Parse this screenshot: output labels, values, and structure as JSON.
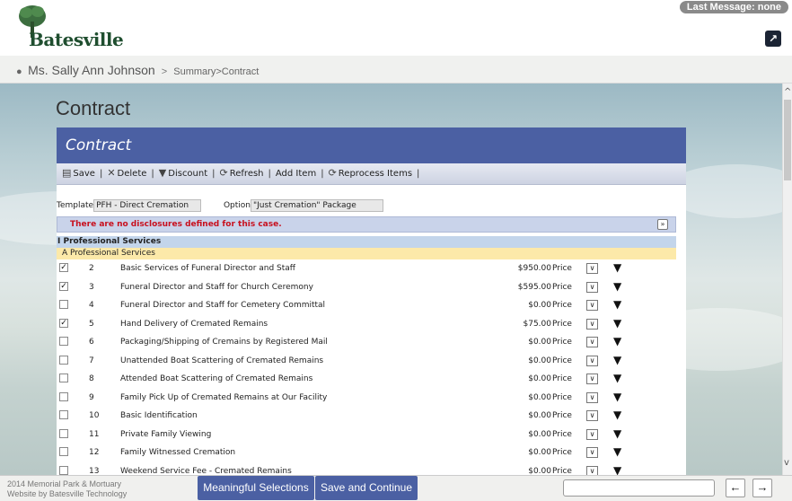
{
  "header": {
    "logo_text": "Batesville",
    "last_message": "Last Message: none",
    "popout_glyph": "↗"
  },
  "breadcrumb": {
    "person_icon": "person-icon",
    "name": "Ms. Sally Ann Johnson",
    "separator": ">",
    "path": "Summary>Contract"
  },
  "page": {
    "title": "Contract"
  },
  "panel": {
    "title": "Contract",
    "toolbar": [
      {
        "label": "Save",
        "icon": "save-icon",
        "glyph": "▤"
      },
      {
        "label": "Delete",
        "icon": "delete-icon",
        "glyph": "✕"
      },
      {
        "label": "Discount",
        "icon": "discount-icon",
        "glyph": "▼"
      },
      {
        "label": "Refresh",
        "icon": "refresh-icon",
        "glyph": "⟳"
      },
      {
        "label": "Add Item",
        "icon": "",
        "glyph": ""
      },
      {
        "label": "Reprocess Items",
        "icon": "reprocess-icon",
        "glyph": "⟳"
      }
    ],
    "template_label": "Template",
    "template_value": "PFH - Direct Cremation",
    "option_label": "Option",
    "option_value": "\"Just Cremation\" Package",
    "notice": "There are no disclosures defined for this case.",
    "notice_toggle": "»",
    "section": "I Professional Services",
    "subsection": "A  Professional Services",
    "rows": [
      {
        "checked": true,
        "num": "2",
        "desc": "Basic Services of Funeral Director and Staff",
        "price": "$950.00",
        "ptype": "Price"
      },
      {
        "checked": true,
        "num": "3",
        "desc": "Funeral Director and Staff for Church Ceremony",
        "price": "$595.00",
        "ptype": "Price"
      },
      {
        "checked": false,
        "num": "4",
        "desc": "Funeral Director and Staff for Cemetery Committal",
        "price": "$0.00",
        "ptype": "Price"
      },
      {
        "checked": true,
        "num": "5",
        "desc": "Hand Delivery of Cremated Remains",
        "price": "$75.00",
        "ptype": "Price"
      },
      {
        "checked": false,
        "num": "6",
        "desc": "Packaging/Shipping of Cremains by Registered Mail",
        "price": "$0.00",
        "ptype": "Price"
      },
      {
        "checked": false,
        "num": "7",
        "desc": "Unattended Boat Scattering of Cremated Remains",
        "price": "$0.00",
        "ptype": "Price"
      },
      {
        "checked": false,
        "num": "8",
        "desc": "Attended Boat Scattering of Cremated Remains",
        "price": "$0.00",
        "ptype": "Price"
      },
      {
        "checked": false,
        "num": "9",
        "desc": "Family Pick Up of Cremated Remains at Our Facility",
        "price": "$0.00",
        "ptype": "Price"
      },
      {
        "checked": false,
        "num": "10",
        "desc": "Basic Identification",
        "price": "$0.00",
        "ptype": "Price"
      },
      {
        "checked": false,
        "num": "11",
        "desc": "Private Family Viewing",
        "price": "$0.00",
        "ptype": "Price"
      },
      {
        "checked": false,
        "num": "12",
        "desc": "Family Witnessed Cremation",
        "price": "$0.00",
        "ptype": "Price"
      },
      {
        "checked": false,
        "num": "13",
        "desc": "Weekend Service Fee - Cremated Remains",
        "price": "$0.00",
        "ptype": "Price"
      }
    ]
  },
  "footer": {
    "copyright_line1": "2014 Memorial Park & Mortuary",
    "copyright_line2": "Website by Batesville Technology",
    "meaningful_label": "Meaningful Selections",
    "save_continue_label": "Save and Continue",
    "prev_glyph": "←",
    "next_glyph": "→"
  },
  "colors": {
    "accent": "#4b60a3",
    "notice_text": "#c8101e",
    "section_bg": "#c3d5eb",
    "subsection_bg": "#fce9a9"
  }
}
